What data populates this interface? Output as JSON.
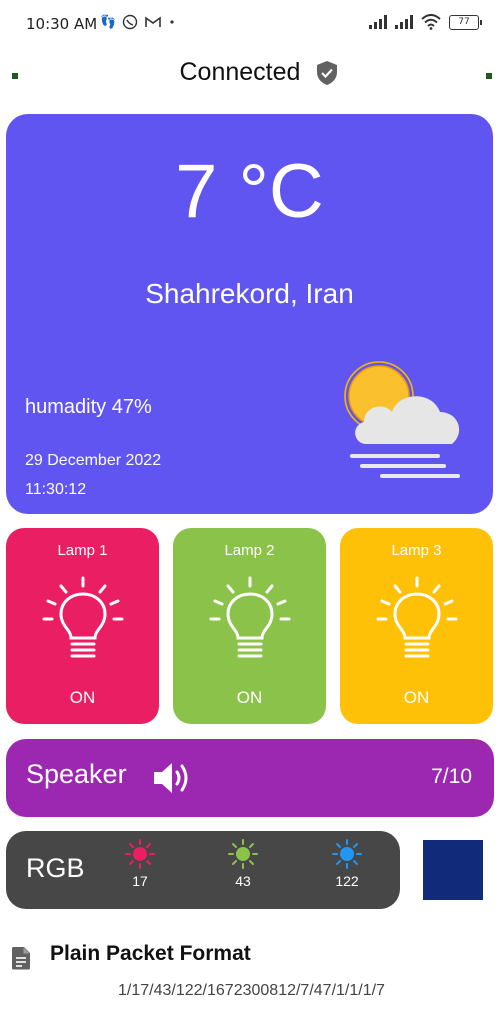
{
  "status_bar": {
    "time": "10:30 AM",
    "battery": "77",
    "icons": [
      "footsteps-icon",
      "phone-icon",
      "gmail-icon",
      "dot-icon",
      "signal-icon",
      "signal-icon",
      "wifi-icon",
      "battery-icon"
    ]
  },
  "header": {
    "title": "Connected",
    "icon": "shield-check-icon"
  },
  "weather": {
    "temperature": "7 °C",
    "location": "Shahrekord, Iran",
    "humidity": "humadity 47%",
    "date": "29 December 2022",
    "time": "11:30:12",
    "icon": "sun-cloud-fog-icon",
    "color": "#6055f0"
  },
  "lamps": [
    {
      "label": "Lamp 1",
      "state": "ON",
      "color": "#e91e63"
    },
    {
      "label": "Lamp 2",
      "state": "ON",
      "color": "#8bc34a"
    },
    {
      "label": "Lamp 3",
      "state": "ON",
      "color": "#ffc107"
    }
  ],
  "speaker": {
    "label": "Speaker",
    "volume": "7/10",
    "icon": "volume-icon",
    "color": "#9c27b0"
  },
  "rgb": {
    "label": "RGB",
    "channels": [
      {
        "value": "17",
        "color": "#e91e63"
      },
      {
        "value": "43",
        "color": "#8bc34a"
      },
      {
        "value": "122",
        "color": "#2196f3"
      }
    ],
    "swatch_color": "#112a7a"
  },
  "packet": {
    "title": "Plain Packet Format",
    "value": "1/17/43/122/1672300812/7/47/1/1/1/7",
    "icon": "document-icon"
  }
}
